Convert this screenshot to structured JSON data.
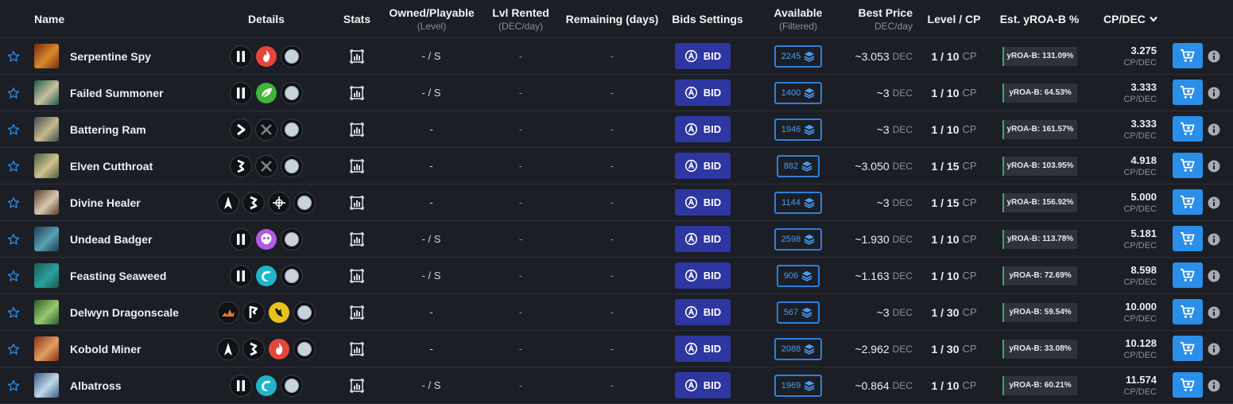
{
  "headers": {
    "name": "Name",
    "details": "Details",
    "stats": "Stats",
    "owned": "Owned/Playable",
    "owned_sub": "(Level)",
    "lvl_rented": "Lvl Rented",
    "lvl_rented_sub": "(DEC/day)",
    "remaining": "Remaining (days)",
    "bids": "Bids Settings",
    "available": "Available",
    "available_sub": "(Filtered)",
    "best_price": "Best Price",
    "best_price_sub": "DEC/day",
    "level_cp": "Level / CP",
    "yroa": "Est. yROA-B %",
    "cpdec": "CP/DEC"
  },
  "labels": {
    "bid": "BID",
    "dec": "DEC",
    "cp": "CP",
    "cp_per_dec": "CP/DEC"
  },
  "colors": {
    "background": "#1b1e25",
    "bid_button": "#2e36a2",
    "cart_button": "#2b8ee8",
    "available_border": "#2f7fd9",
    "yroa_accent": "#3ea85a"
  },
  "rows": [
    {
      "name": "Serpentine Spy",
      "icons": [
        "melee-attack-icon",
        "fire-element-icon",
        "neutral-rarity-icon"
      ],
      "owned": "- / S",
      "lvl_rented": "-",
      "remaining": "-",
      "available": "2245",
      "best_price": "~3.053",
      "level": "1 / 10",
      "yroa": "yROA-B: 131.09%",
      "cpdec": "3.275"
    },
    {
      "name": "Failed Summoner",
      "icons": [
        "melee-attack-icon",
        "earth-element-icon",
        "neutral-rarity-icon"
      ],
      "owned": "- / S",
      "lvl_rented": "-",
      "remaining": "-",
      "available": "1400",
      "best_price": "~3",
      "level": "1 / 10",
      "yroa": "yROA-B: 64.53%",
      "cpdec": "3.333"
    },
    {
      "name": "Battering Ram",
      "icons": [
        "sneak-ability-icon",
        "no-attack-icon",
        "neutral-rarity-icon"
      ],
      "owned": "-",
      "lvl_rented": "-",
      "remaining": "-",
      "available": "1946",
      "best_price": "~3",
      "level": "1 / 10",
      "yroa": "yROA-B: 161.57%",
      "cpdec": "3.333"
    },
    {
      "name": "Elven Cutthroat",
      "icons": [
        "opportunity-ability-icon",
        "no-attack-icon",
        "neutral-rarity-icon"
      ],
      "owned": "-",
      "lvl_rented": "-",
      "remaining": "-",
      "available": "882",
      "best_price": "~3.050",
      "level": "1 / 15",
      "yroa": "yROA-B: 103.95%",
      "cpdec": "4.918"
    },
    {
      "name": "Divine Healer",
      "icons": [
        "ranged-attack-icon",
        "opportunity-ability-icon",
        "life-element-icon",
        "neutral-rarity-icon"
      ],
      "owned": "-",
      "lvl_rented": "-",
      "remaining": "-",
      "available": "1144",
      "best_price": "~3",
      "level": "1 / 15",
      "yroa": "yROA-B: 156.92%",
      "cpdec": "5.000"
    },
    {
      "name": "Undead Badger",
      "icons": [
        "melee-attack-icon",
        "death-element-icon",
        "neutral-rarity-icon"
      ],
      "owned": "- / S",
      "lvl_rented": "-",
      "remaining": "-",
      "available": "2598",
      "best_price": "~1.930",
      "level": "1 / 10",
      "yroa": "yROA-B: 113.78%",
      "cpdec": "5.181"
    },
    {
      "name": "Feasting Seaweed",
      "icons": [
        "melee-attack-icon",
        "water-element-icon",
        "neutral-rarity-icon"
      ],
      "owned": "- / S",
      "lvl_rented": "-",
      "remaining": "-",
      "available": "906",
      "best_price": "~1.163",
      "level": "1 / 10",
      "yroa": "yROA-B: 72.69%",
      "cpdec": "8.598"
    },
    {
      "name": "Delwyn Dragonscale",
      "icons": [
        "dragon-splinter-icon",
        "flag-ability-icon",
        "dragon-element-icon",
        "neutral-rarity-icon"
      ],
      "owned": "-",
      "lvl_rented": "-",
      "remaining": "-",
      "available": "567",
      "best_price": "~3",
      "level": "1 / 30",
      "yroa": "yROA-B: 59.54%",
      "cpdec": "10.000"
    },
    {
      "name": "Kobold Miner",
      "icons": [
        "ranged-attack-icon",
        "opportunity-ability-icon",
        "fire-element-icon",
        "neutral-rarity-icon"
      ],
      "owned": "-",
      "lvl_rented": "-",
      "remaining": "-",
      "available": "2088",
      "best_price": "~2.962",
      "level": "1 / 30",
      "yroa": "yROA-B: 33.08%",
      "cpdec": "10.128"
    },
    {
      "name": "Albatross",
      "icons": [
        "melee-attack-icon",
        "water-element-icon",
        "neutral-rarity-icon"
      ],
      "owned": "- / S",
      "lvl_rented": "-",
      "remaining": "-",
      "available": "1969",
      "best_price": "~0.864",
      "level": "1 / 10",
      "yroa": "yROA-B: 60.21%",
      "cpdec": "11.574"
    }
  ]
}
